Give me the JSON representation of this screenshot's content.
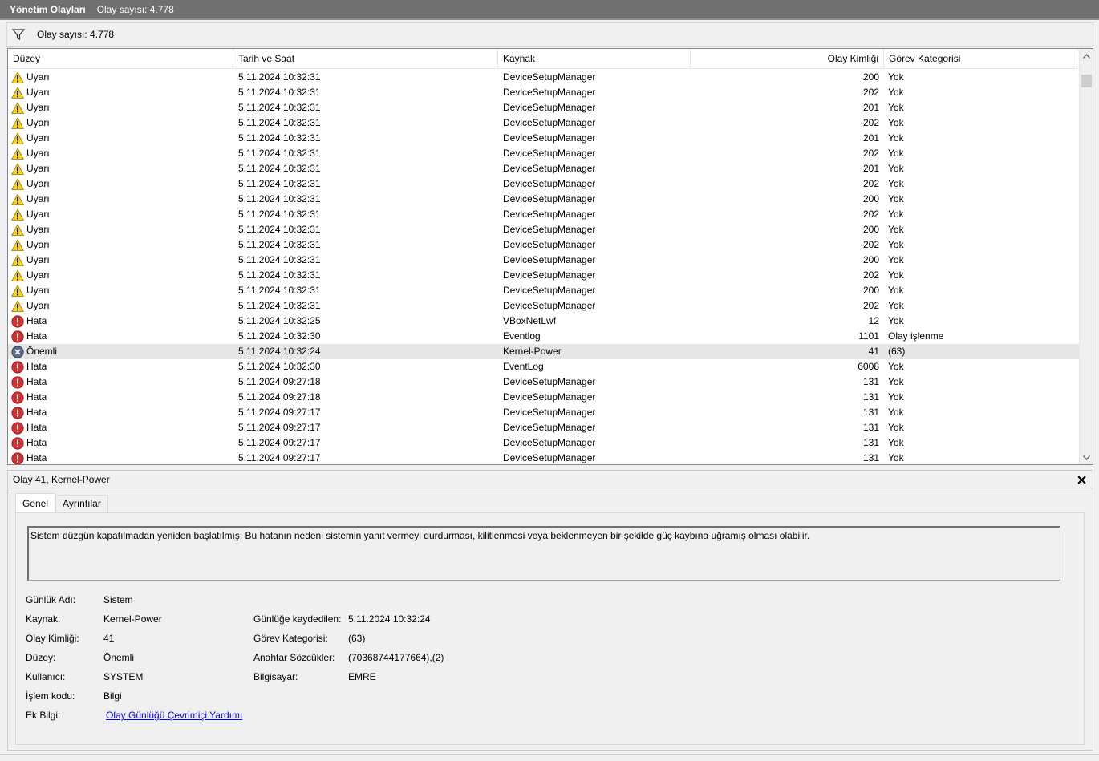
{
  "title": {
    "name": "Yönetim Olayları",
    "count": "Olay sayısı: 4.778"
  },
  "filter_bar": {
    "icon": "filter-icon",
    "count": "Olay sayısı: 4.778"
  },
  "grid": {
    "columns": [
      "Düzey",
      "Tarih ve Saat",
      "Kaynak",
      "Olay Kimliği",
      "Görev Kategorisi"
    ],
    "rows": [
      {
        "level": "Uyarı",
        "icon": "warning-icon",
        "date": "5.11.2024 10:32:31",
        "source": "DeviceSetupManager",
        "id": "200",
        "category": "Yok"
      },
      {
        "level": "Uyarı",
        "icon": "warning-icon",
        "date": "5.11.2024 10:32:31",
        "source": "DeviceSetupManager",
        "id": "202",
        "category": "Yok"
      },
      {
        "level": "Uyarı",
        "icon": "warning-icon",
        "date": "5.11.2024 10:32:31",
        "source": "DeviceSetupManager",
        "id": "201",
        "category": "Yok"
      },
      {
        "level": "Uyarı",
        "icon": "warning-icon",
        "date": "5.11.2024 10:32:31",
        "source": "DeviceSetupManager",
        "id": "202",
        "category": "Yok"
      },
      {
        "level": "Uyarı",
        "icon": "warning-icon",
        "date": "5.11.2024 10:32:31",
        "source": "DeviceSetupManager",
        "id": "201",
        "category": "Yok"
      },
      {
        "level": "Uyarı",
        "icon": "warning-icon",
        "date": "5.11.2024 10:32:31",
        "source": "DeviceSetupManager",
        "id": "202",
        "category": "Yok"
      },
      {
        "level": "Uyarı",
        "icon": "warning-icon",
        "date": "5.11.2024 10:32:31",
        "source": "DeviceSetupManager",
        "id": "201",
        "category": "Yok"
      },
      {
        "level": "Uyarı",
        "icon": "warning-icon",
        "date": "5.11.2024 10:32:31",
        "source": "DeviceSetupManager",
        "id": "202",
        "category": "Yok"
      },
      {
        "level": "Uyarı",
        "icon": "warning-icon",
        "date": "5.11.2024 10:32:31",
        "source": "DeviceSetupManager",
        "id": "200",
        "category": "Yok"
      },
      {
        "level": "Uyarı",
        "icon": "warning-icon",
        "date": "5.11.2024 10:32:31",
        "source": "DeviceSetupManager",
        "id": "202",
        "category": "Yok"
      },
      {
        "level": "Uyarı",
        "icon": "warning-icon",
        "date": "5.11.2024 10:32:31",
        "source": "DeviceSetupManager",
        "id": "200",
        "category": "Yok"
      },
      {
        "level": "Uyarı",
        "icon": "warning-icon",
        "date": "5.11.2024 10:32:31",
        "source": "DeviceSetupManager",
        "id": "202",
        "category": "Yok"
      },
      {
        "level": "Uyarı",
        "icon": "warning-icon",
        "date": "5.11.2024 10:32:31",
        "source": "DeviceSetupManager",
        "id": "200",
        "category": "Yok"
      },
      {
        "level": "Uyarı",
        "icon": "warning-icon",
        "date": "5.11.2024 10:32:31",
        "source": "DeviceSetupManager",
        "id": "202",
        "category": "Yok"
      },
      {
        "level": "Uyarı",
        "icon": "warning-icon",
        "date": "5.11.2024 10:32:31",
        "source": "DeviceSetupManager",
        "id": "200",
        "category": "Yok"
      },
      {
        "level": "Uyarı",
        "icon": "warning-icon",
        "date": "5.11.2024 10:32:31",
        "source": "DeviceSetupManager",
        "id": "202",
        "category": "Yok"
      },
      {
        "level": "Hata",
        "icon": "error-icon",
        "date": "5.11.2024 10:32:25",
        "source": "VBoxNetLwf",
        "id": "12",
        "category": "Yok"
      },
      {
        "level": "Hata",
        "icon": "error-icon",
        "date": "5.11.2024 10:32:30",
        "source": "Eventlog",
        "id": "1101",
        "category": "Olay işlenme"
      },
      {
        "level": "Önemli",
        "icon": "critical-icon",
        "date": "5.11.2024 10:32:24",
        "source": "Kernel-Power",
        "id": "41",
        "category": "(63)",
        "selected": true
      },
      {
        "level": "Hata",
        "icon": "error-icon",
        "date": "5.11.2024 10:32:30",
        "source": "EventLog",
        "id": "6008",
        "category": "Yok"
      },
      {
        "level": "Hata",
        "icon": "error-icon",
        "date": "5.11.2024 09:27:18",
        "source": "DeviceSetupManager",
        "id": "131",
        "category": "Yok"
      },
      {
        "level": "Hata",
        "icon": "error-icon",
        "date": "5.11.2024 09:27:18",
        "source": "DeviceSetupManager",
        "id": "131",
        "category": "Yok"
      },
      {
        "level": "Hata",
        "icon": "error-icon",
        "date": "5.11.2024 09:27:17",
        "source": "DeviceSetupManager",
        "id": "131",
        "category": "Yok"
      },
      {
        "level": "Hata",
        "icon": "error-icon",
        "date": "5.11.2024 09:27:17",
        "source": "DeviceSetupManager",
        "id": "131",
        "category": "Yok"
      },
      {
        "level": "Hata",
        "icon": "error-icon",
        "date": "5.11.2024 09:27:17",
        "source": "DeviceSetupManager",
        "id": "131",
        "category": "Yok"
      },
      {
        "level": "Hata",
        "icon": "error-icon",
        "date": "5.11.2024 09:27:17",
        "source": "DeviceSetupManager",
        "id": "131",
        "category": "Yok"
      }
    ]
  },
  "details": {
    "header": "Olay 41, Kernel-Power",
    "close_icon": "close-icon",
    "tabs": [
      "Genel",
      "Ayrıntılar"
    ],
    "description": "Sistem düzgün kapatılmadan yeniden başlatılmış. Bu hatanın nedeni sistemin yanıt vermeyi durdurması, kilitlenmesi veya beklenmeyen bir şekilde güç kaybına uğramış olması olabilir.",
    "left": [
      {
        "label": "Günlük Adı:",
        "value": "Sistem"
      },
      {
        "label": "Kaynak:",
        "value": "Kernel-Power"
      },
      {
        "label": "Olay Kimliği:",
        "value": "41"
      },
      {
        "label": "Düzey:",
        "value": "Önemli"
      },
      {
        "label": "Kullanıcı:",
        "value": "SYSTEM"
      },
      {
        "label": "İşlem kodu:",
        "value": "Bilgi"
      },
      {
        "label": "Ek Bilgi:",
        "value": "Olay Günlüğü Çevrimiçi Yardımı"
      }
    ],
    "right": [
      {
        "label": "Günlüğe kaydedilen:",
        "value": "5.11.2024 10:32:24"
      },
      {
        "label": "Görev Kategorisi:",
        "value": "(63)"
      },
      {
        "label": "Anahtar Sözcükler:",
        "value": "(70368744177664),(2)"
      },
      {
        "label": "Bilgisayar:",
        "value": "EMRE"
      }
    ]
  },
  "colors": {
    "titlebar": "#707070",
    "warning": "#f7d21a",
    "error": "#d32f2f",
    "critical": "#5a6a8a",
    "link": "#0000ee",
    "selected_row": "#e6e6e6"
  }
}
